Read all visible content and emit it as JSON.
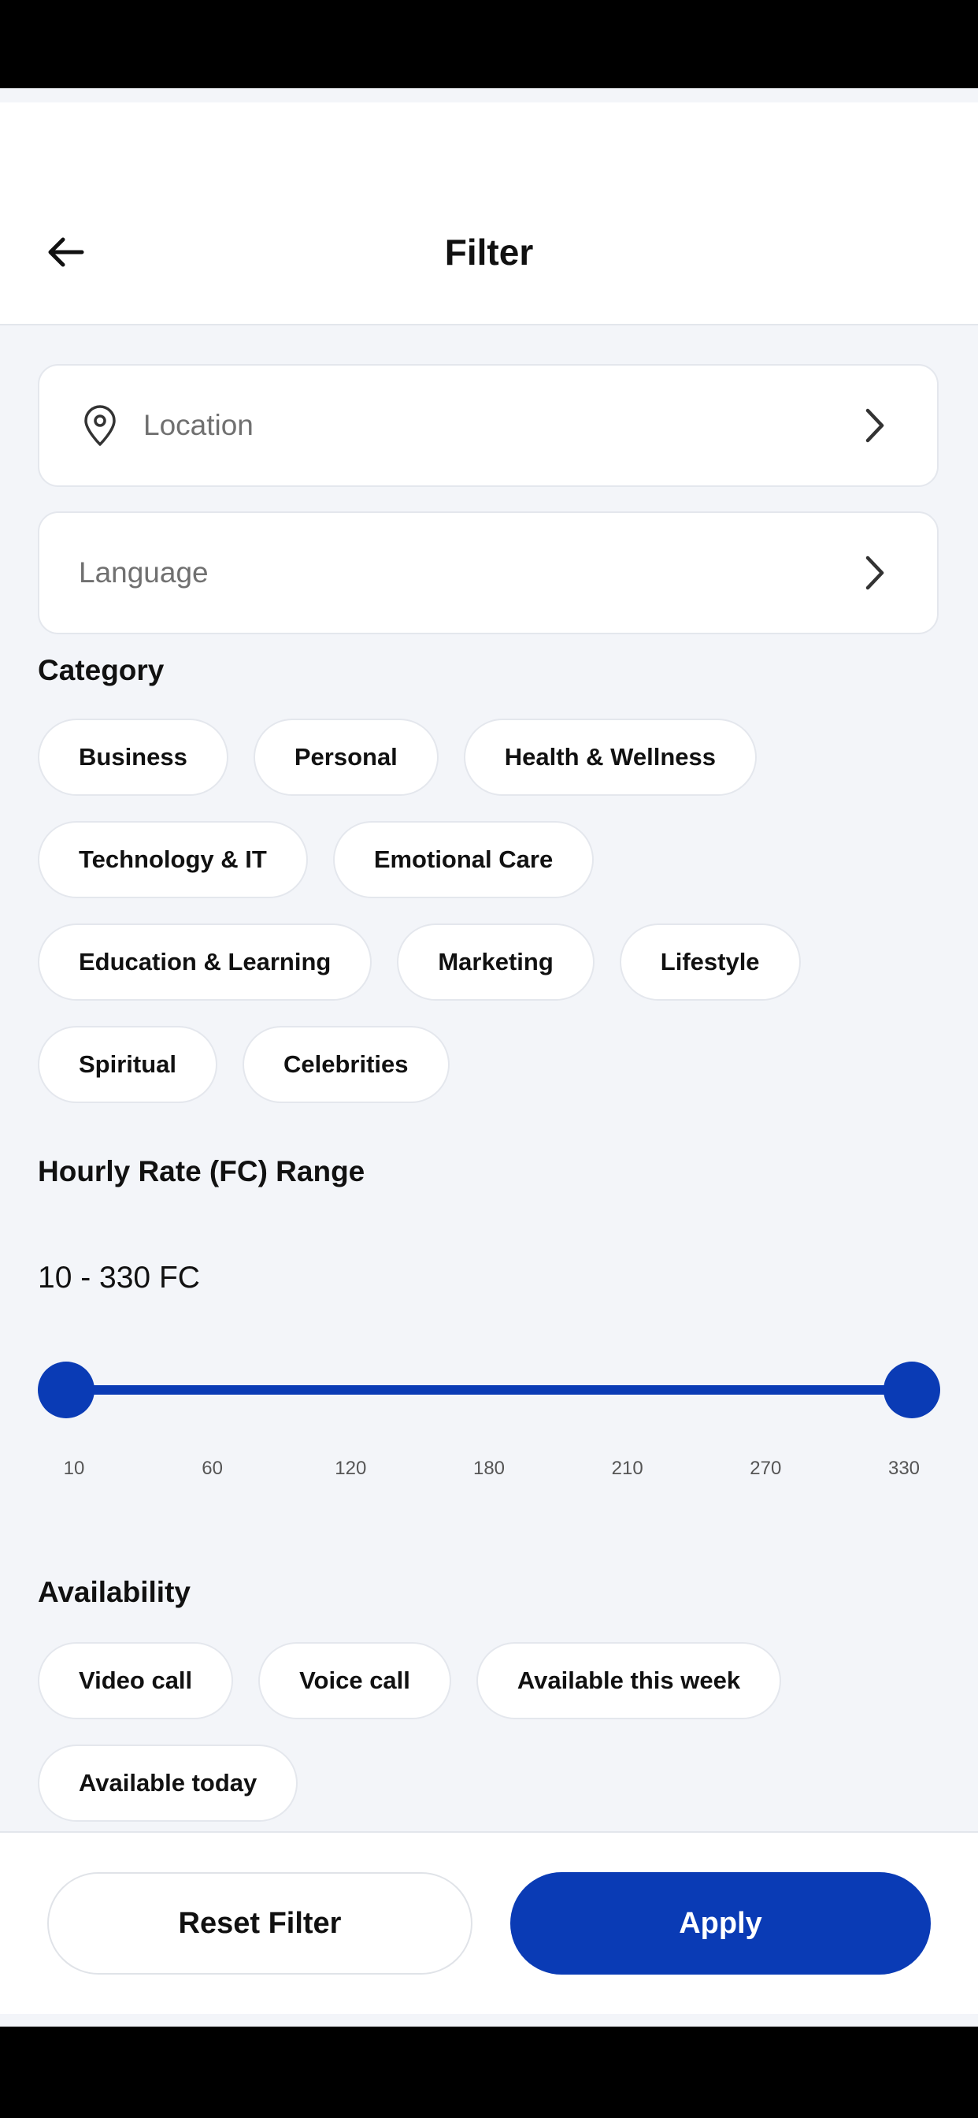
{
  "header": {
    "title": "Filter",
    "back_icon": "arrow-left-icon"
  },
  "fields": {
    "location": {
      "label": "Location",
      "icon": "map-pin-icon"
    },
    "language": {
      "label": "Language"
    }
  },
  "category": {
    "title": "Category",
    "rows": [
      [
        "Business",
        "Personal",
        "Health & Wellness"
      ],
      [
        "Technology & IT",
        "Emotional Care"
      ],
      [
        "Education & Learning",
        "Marketing",
        "Lifestyle"
      ],
      [
        "Spiritual",
        "Celebrities"
      ]
    ]
  },
  "rate": {
    "title": "Hourly Rate (FC) Range",
    "value_text": "10 - 330 FC",
    "min": 10,
    "max": 330,
    "selected_min": 10,
    "selected_max": 330,
    "ticks": [
      "10",
      "60",
      "120",
      "180",
      "210",
      "270",
      "330"
    ]
  },
  "availability": {
    "title": "Availability",
    "rows": [
      [
        "Video call",
        "Voice call",
        "Available this week"
      ],
      [
        "Available today"
      ]
    ]
  },
  "footer": {
    "reset_label": "Reset Filter",
    "apply_label": "Apply"
  },
  "colors": {
    "accent": "#0a3bb5",
    "background": "#f3f5f9",
    "card": "#ffffff"
  }
}
